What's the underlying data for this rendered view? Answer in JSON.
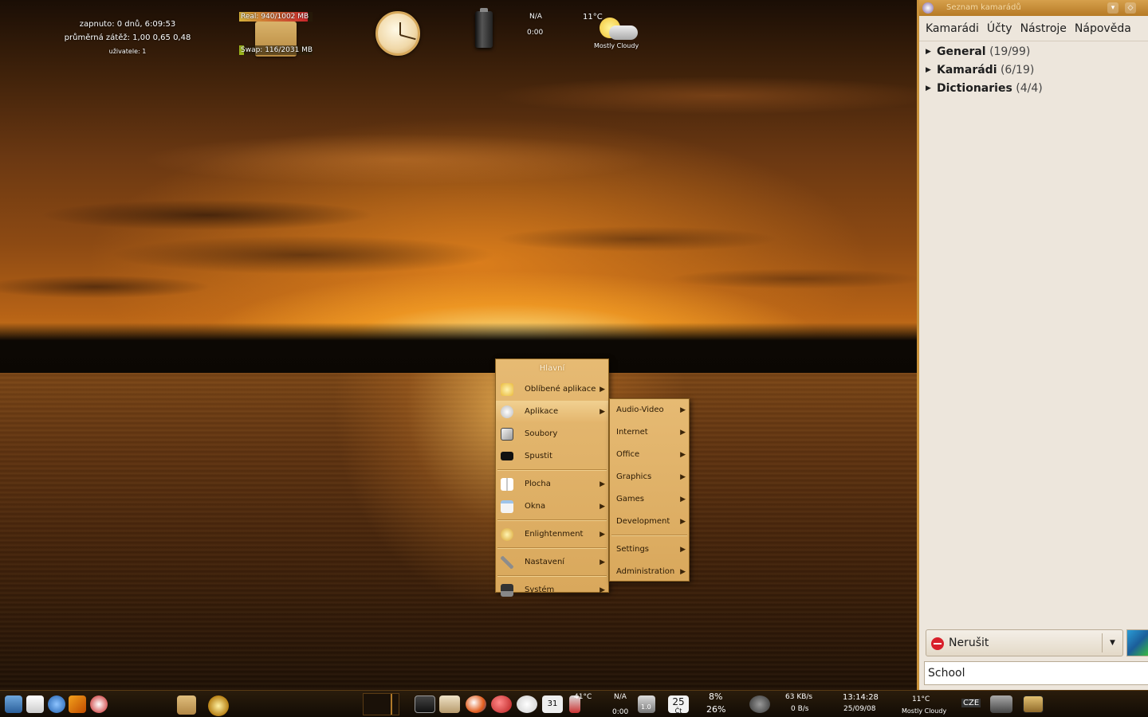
{
  "desktop": {
    "sysinfo": {
      "uptime": "zapnuto: 0 dnů, 6:09:53",
      "load": "průměrná zátěž: 1,00 0,65 0,48",
      "users": "uživatele: 1"
    },
    "memory": {
      "real_label": "Real: 940/1002 MB",
      "real_fraction": 0.94,
      "swap_label": "Swap: 116/2031 MB",
      "swap_fraction": 0.06
    },
    "battery": {
      "status": "N/A",
      "time": "0:00"
    },
    "weather": {
      "temp": "11°C",
      "condition": "Mostly Cloudy"
    }
  },
  "main_menu": {
    "title": "Hlavní",
    "items": [
      {
        "label": "Oblíbené aplikace",
        "icon": "heart-icon",
        "submenu": true
      },
      {
        "label": "Aplikace",
        "icon": "gear-icon",
        "submenu": true,
        "highlighted": true
      },
      {
        "label": "Soubory",
        "icon": "folder-icon",
        "submenu": false
      },
      {
        "label": "Spustit",
        "icon": "terminal-icon",
        "submenu": false
      },
      {
        "label": "Plocha",
        "icon": "desktop-icon",
        "submenu": true
      },
      {
        "label": "Okna",
        "icon": "window-icon",
        "submenu": true
      },
      {
        "label": "Enlightenment",
        "icon": "enlightenment-icon",
        "submenu": true
      },
      {
        "label": "Nastavení",
        "icon": "wrench-icon",
        "submenu": true
      },
      {
        "label": "Systém",
        "icon": "laptop-icon",
        "submenu": true
      }
    ]
  },
  "sub_menu": {
    "items": [
      {
        "label": "Audio-Video"
      },
      {
        "label": "Internet"
      },
      {
        "label": "Office"
      },
      {
        "label": "Graphics"
      },
      {
        "label": "Games"
      },
      {
        "label": "Development"
      },
      {
        "label": "Settings"
      },
      {
        "label": "Administration"
      }
    ]
  },
  "buddy_list": {
    "title": "Seznam kamarádů",
    "menu": [
      "Kamarádi",
      "Účty",
      "Nástroje",
      "Nápověda"
    ],
    "groups": [
      {
        "name": "General",
        "count": "(19/99)"
      },
      {
        "name": "Kamarádi",
        "count": "(6/19)"
      },
      {
        "name": "Dictionaries",
        "count": "(4/4)"
      }
    ],
    "status": "Nerušit",
    "status_message": "School"
  },
  "shelf": {
    "temperature": "41°C",
    "battery_status": "N/A",
    "battery_time": "0:00",
    "cpu_label": "1.0",
    "calendar_day": "25",
    "calendar_weekday": "Čt",
    "cpu_percent_top": "8%",
    "cpu_percent_bottom": "26%",
    "net_down": "63 KB/s",
    "net_up": "0 B/s",
    "clock_time": "13:14:28",
    "clock_date": "25/09/08",
    "weather_temp": "11°C",
    "weather_condition": "Mostly Cloudy",
    "keyboard_layout": "CZE",
    "calendar_icon_label": "31"
  },
  "colors": {
    "menu_bg": "#e2b46a",
    "menu_border": "#8c6221",
    "window_accent": "#c9923b",
    "dnd_red": "#d8202b"
  }
}
